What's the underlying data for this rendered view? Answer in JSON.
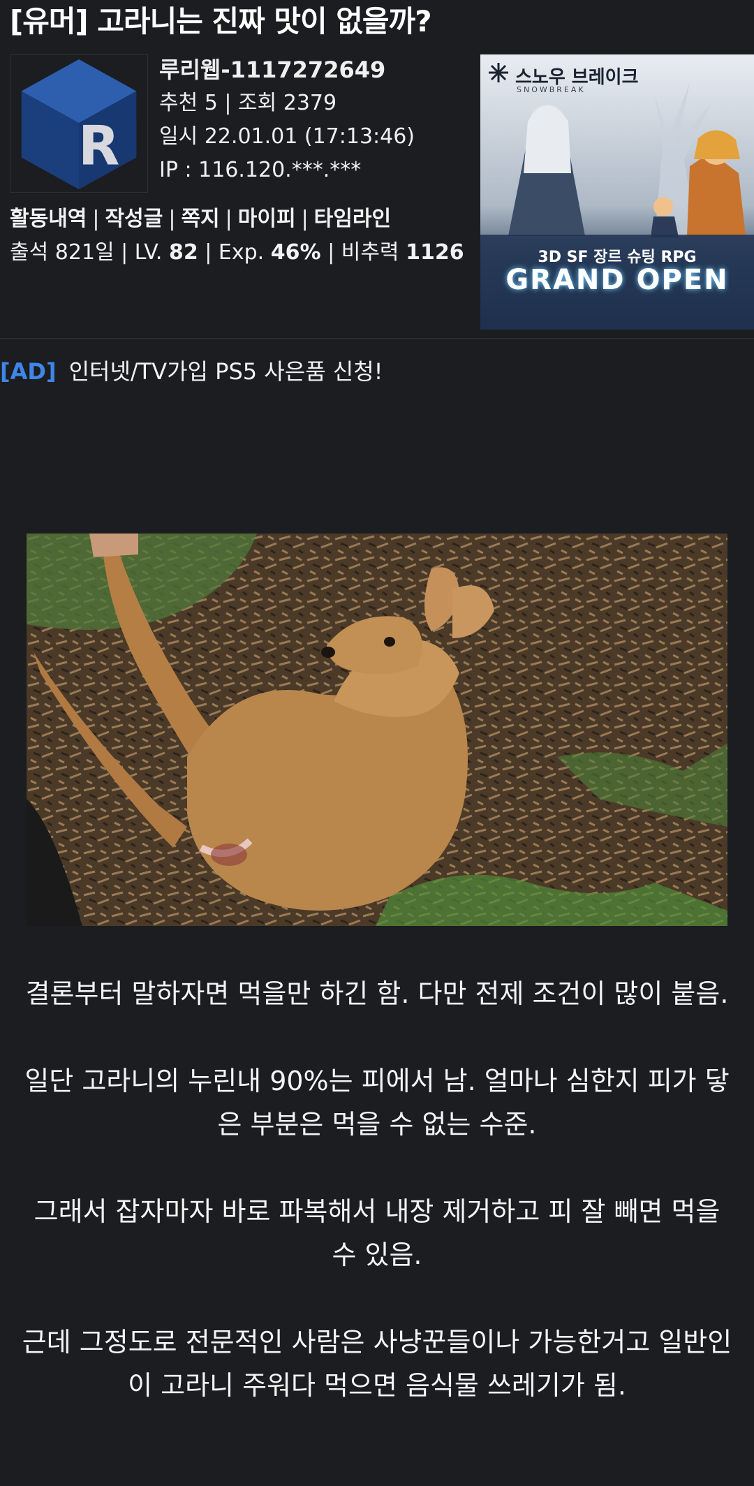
{
  "post": {
    "title": "[유머] 고라니는 진짜 맛이 없을까?"
  },
  "author": {
    "nickname": "루리웹-1117272649",
    "recommend_views": "추천 5 | 조회 2379",
    "datetime": "일시 22.01.01 (17:13:46)",
    "ip": "IP : 116.120.***.***",
    "avatar_letter": "R"
  },
  "profile_links": {
    "activity": "활동내역",
    "posts": "작성글",
    "message": "쪽지",
    "mypi": "마이피",
    "timeline": "타임라인",
    "separator": "|"
  },
  "profile_stats": {
    "attendance": "출석 821일 |",
    "level_label": "LV.",
    "level_value": "82",
    "exp_label": "| Exp.",
    "exp_value": "46%",
    "power_label": "| 비추력",
    "power_value": "1126"
  },
  "banner_ad": {
    "brand": "스노우 브레이크",
    "brand_sub": "SNOWBREAK",
    "genre": "3D SF 장르 슈팅 RPG",
    "headline": "GRAND OPEN"
  },
  "text_ad": {
    "tag": "[AD]",
    "text": "인터넷/TV가입 PS5 사은품 신청!"
  },
  "content": {
    "paragraphs": [
      "결론부터 말하자면 먹을만 하긴 함. 다만 전제 조건이 많이 붙음.",
      "일단 고라니의 누린내 90%는 피에서 남. 얼마나 심한지 피가 닿은 부분은 먹을 수 없는 수준.",
      "그래서 잡자마자 바로 파복해서 내장 제거하고 피 잘 빼면 먹을 수 있음.",
      "근데 그정도로 전문적인 사람은 사냥꾼들이나 가능한거고 일반인이 고라니 주워다 먹으면 음식물 쓰레기가 됨."
    ]
  },
  "colors": {
    "background": "#1b1d21",
    "text": "#f2f2f2",
    "ad_tag": "#3f86e6",
    "avatar_cube": "#1f4a8f"
  }
}
